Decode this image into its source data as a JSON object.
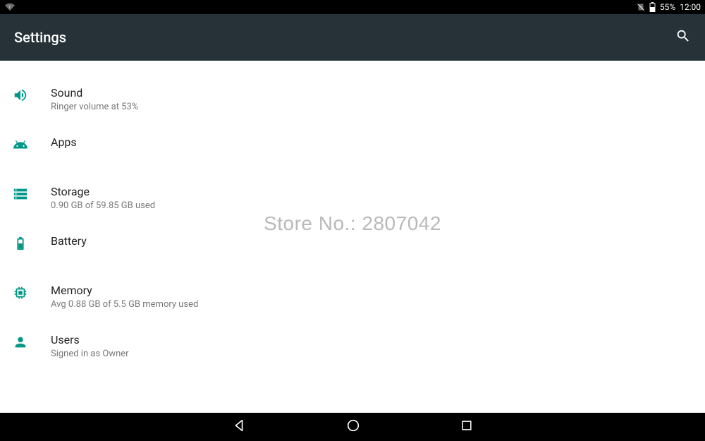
{
  "statusbar": {
    "battery_text": "55%",
    "clock": "12:00"
  },
  "appbar": {
    "title": "Settings"
  },
  "items": [
    {
      "icon": "sound",
      "label": "Sound",
      "sub": "Ringer volume at 53%"
    },
    {
      "icon": "apps",
      "label": "Apps",
      "sub": ""
    },
    {
      "icon": "storage",
      "label": "Storage",
      "sub": "0.90 GB of 59.85 GB used"
    },
    {
      "icon": "battery",
      "label": "Battery",
      "sub": ""
    },
    {
      "icon": "memory",
      "label": "Memory",
      "sub": "Avg 0.88 GB of 5.5 GB memory used"
    },
    {
      "icon": "users",
      "label": "Users",
      "sub": "Signed in as Owner"
    }
  ],
  "watermark": "Store No.: 2807042",
  "accent": "#009688"
}
